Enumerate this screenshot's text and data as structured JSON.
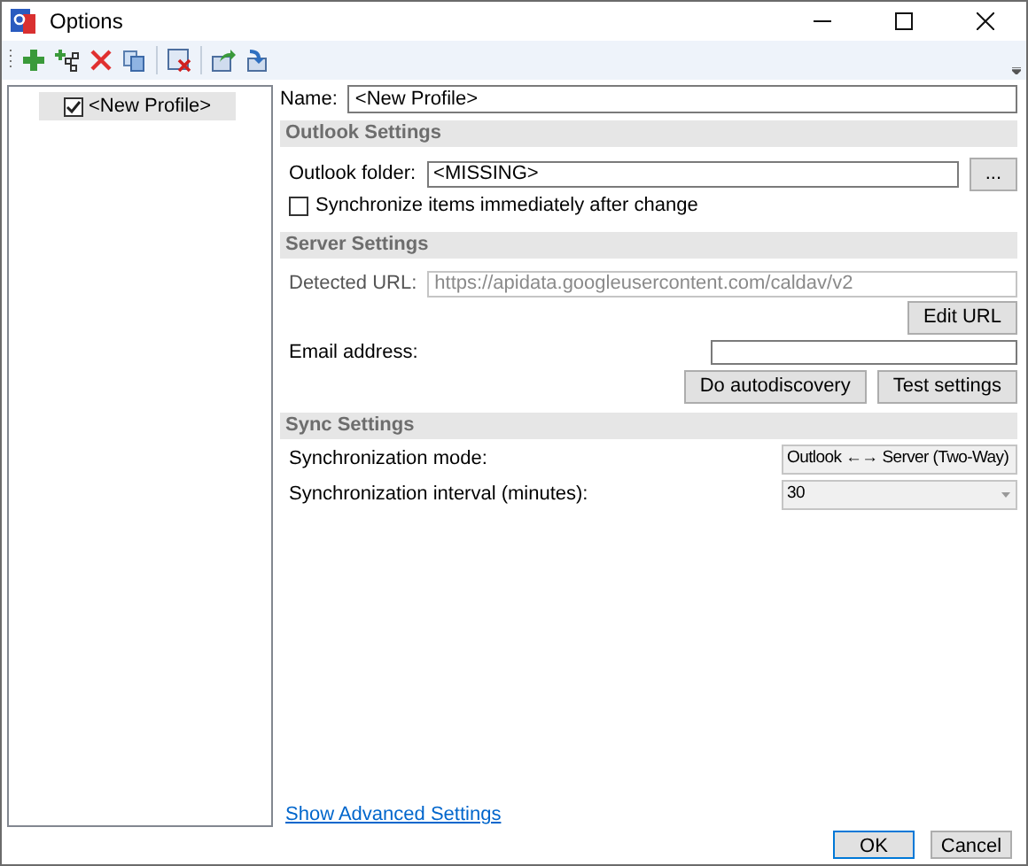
{
  "window": {
    "title": "Options"
  },
  "toolbar": [
    {
      "kind": "add"
    },
    {
      "kind": "add-multiple"
    },
    {
      "kind": "delete"
    },
    {
      "kind": "copy"
    },
    {
      "kind": "clear"
    },
    {
      "kind": "export"
    },
    {
      "kind": "import"
    }
  ],
  "profiles": [
    {
      "label": "<New Profile>",
      "checked": true,
      "selected": true
    }
  ],
  "name": {
    "label": "Name:",
    "value": "<New Profile>"
  },
  "outlook_settings": {
    "header": "Outlook Settings",
    "folder_label": "Outlook folder:",
    "folder_value": "<MISSING>",
    "browse_button": "...",
    "sync_immediately": {
      "label": "Synchronize items immediately after change",
      "checked": false
    }
  },
  "server_settings": {
    "header": "Server Settings",
    "url_label": "Detected URL:",
    "url_value": "https://apidata.googleusercontent.com/caldav/v2",
    "edit_url_button": "Edit URL",
    "email_label": "Email address:",
    "autodiscovery_button": "Do autodiscovery",
    "test_button": "Test settings"
  },
  "sync_settings": {
    "header": "Sync Settings",
    "rows": [
      {
        "label": "Synchronization mode:",
        "value": "Outlook ←→ Server (Two-Way)"
      },
      {
        "label": "Synchronization interval (minutes):",
        "value": "30"
      }
    ]
  },
  "advanced_link": "Show Advanced Settings",
  "buttons": [
    {
      "label": "OK",
      "default": true
    },
    {
      "label": "Cancel",
      "default": false
    }
  ]
}
